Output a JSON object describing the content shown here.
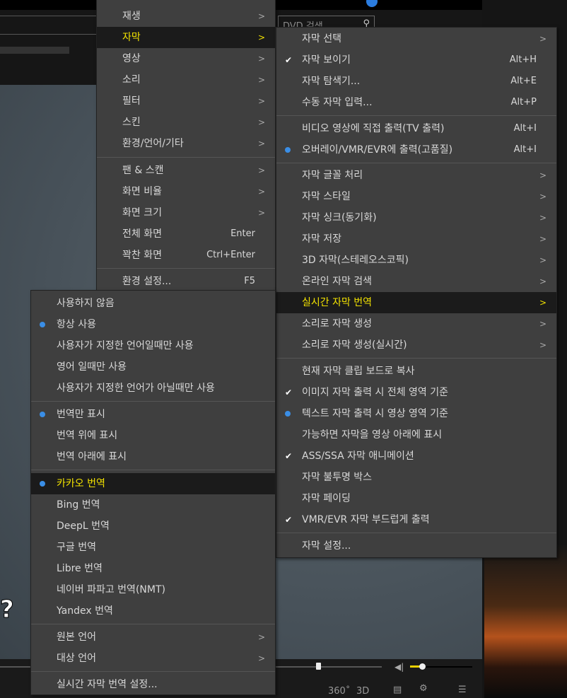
{
  "header": {
    "search_label": "DVD 검색"
  },
  "controls": {
    "btn_360": "360˚",
    "btn_3d": "3D"
  },
  "main_menu": {
    "items": [
      {
        "label": "재생",
        "arrow": ">"
      },
      {
        "label": "자막",
        "arrow": ">",
        "highlighted": true
      },
      {
        "label": "영상",
        "arrow": ">"
      },
      {
        "label": "소리",
        "arrow": ">"
      },
      {
        "label": "필터",
        "arrow": ">"
      },
      {
        "label": "스킨",
        "arrow": ">"
      },
      {
        "label": "환경/언어/기타",
        "arrow": ">"
      },
      {
        "label": "팬 & 스캔",
        "arrow": ">"
      },
      {
        "label": "화면 비율",
        "arrow": ">"
      },
      {
        "label": "화면 크기",
        "arrow": ">"
      },
      {
        "label": "전체 화면",
        "shortcut": "Enter"
      },
      {
        "label": "꽉찬 화면",
        "shortcut": "Ctrl+Enter"
      },
      {
        "label": "환경 설정...",
        "shortcut": "F5"
      }
    ]
  },
  "subtitle_menu": {
    "items": [
      {
        "label": "자막 선택",
        "arrow": ">"
      },
      {
        "label": "자막 보이기",
        "shortcut": "Alt+H",
        "check": true
      },
      {
        "label": "자막 탐색기...",
        "shortcut": "Alt+E"
      },
      {
        "label": "수동 자막 입력...",
        "shortcut": "Alt+P"
      },
      {
        "label": "비디오 영상에 직접 출력(TV 출력)",
        "shortcut": "Alt+I"
      },
      {
        "label": "오버레이/VMR/EVR에 출력(고품질)",
        "shortcut": "Alt+I",
        "radio": true
      },
      {
        "label": "자막 글꼴 처리",
        "arrow": ">"
      },
      {
        "label": "자막 스타일",
        "arrow": ">"
      },
      {
        "label": "자막 싱크(동기화)",
        "arrow": ">"
      },
      {
        "label": "자막 저장",
        "arrow": ">"
      },
      {
        "label": "3D 자막(스테레오스코픽)",
        "arrow": ">"
      },
      {
        "label": "온라인 자막 검색",
        "arrow": ">"
      },
      {
        "label": "실시간 자막 번역",
        "arrow": ">",
        "highlighted": true
      },
      {
        "label": "소리로 자막 생성",
        "arrow": ">"
      },
      {
        "label": "소리로 자막 생성(실시간)",
        "arrow": ">"
      },
      {
        "label": "현재 자막 클립 보드로 복사"
      },
      {
        "label": "이미지 자막 출력 시 전체 영역 기준",
        "check": true
      },
      {
        "label": "텍스트 자막 출력 시 영상 영역 기준",
        "radio": true
      },
      {
        "label": "가능하면 자막을 영상 아래에 표시"
      },
      {
        "label": "ASS/SSA 자막 애니메이션",
        "check": true
      },
      {
        "label": "자막 불투명 박스"
      },
      {
        "label": "자막 페이딩"
      },
      {
        "label": "VMR/EVR 자막 부드럽게 출력",
        "check": true
      },
      {
        "label": "자막 설정..."
      }
    ]
  },
  "translation_menu": {
    "items": [
      {
        "label": "사용하지 않음"
      },
      {
        "label": "항상 사용",
        "radio": true
      },
      {
        "label": "사용자가 지정한 언어일때만 사용"
      },
      {
        "label": "영어 일때만 사용"
      },
      {
        "label": "사용자가 지정한 언어가 아닐때만 사용"
      },
      {
        "label": "번역만 표시",
        "radio": true
      },
      {
        "label": "번역 위에 표시"
      },
      {
        "label": "번역 아래에 표시"
      },
      {
        "label": "카카오 번역",
        "radio": true,
        "highlighted": true
      },
      {
        "label": "Bing 번역"
      },
      {
        "label": "DeepL 번역"
      },
      {
        "label": "구글 번역"
      },
      {
        "label": "Libre 번역"
      },
      {
        "label": "네이버 파파고 번역(NMT)"
      },
      {
        "label": "Yandex 번역"
      },
      {
        "label": "원본 언어",
        "arrow": ">"
      },
      {
        "label": "대상 언어",
        "arrow": ">"
      },
      {
        "label": "실시간 자막 번역 설정..."
      }
    ]
  },
  "accent": "#f2e200",
  "radio_color": "#3a8ee6"
}
